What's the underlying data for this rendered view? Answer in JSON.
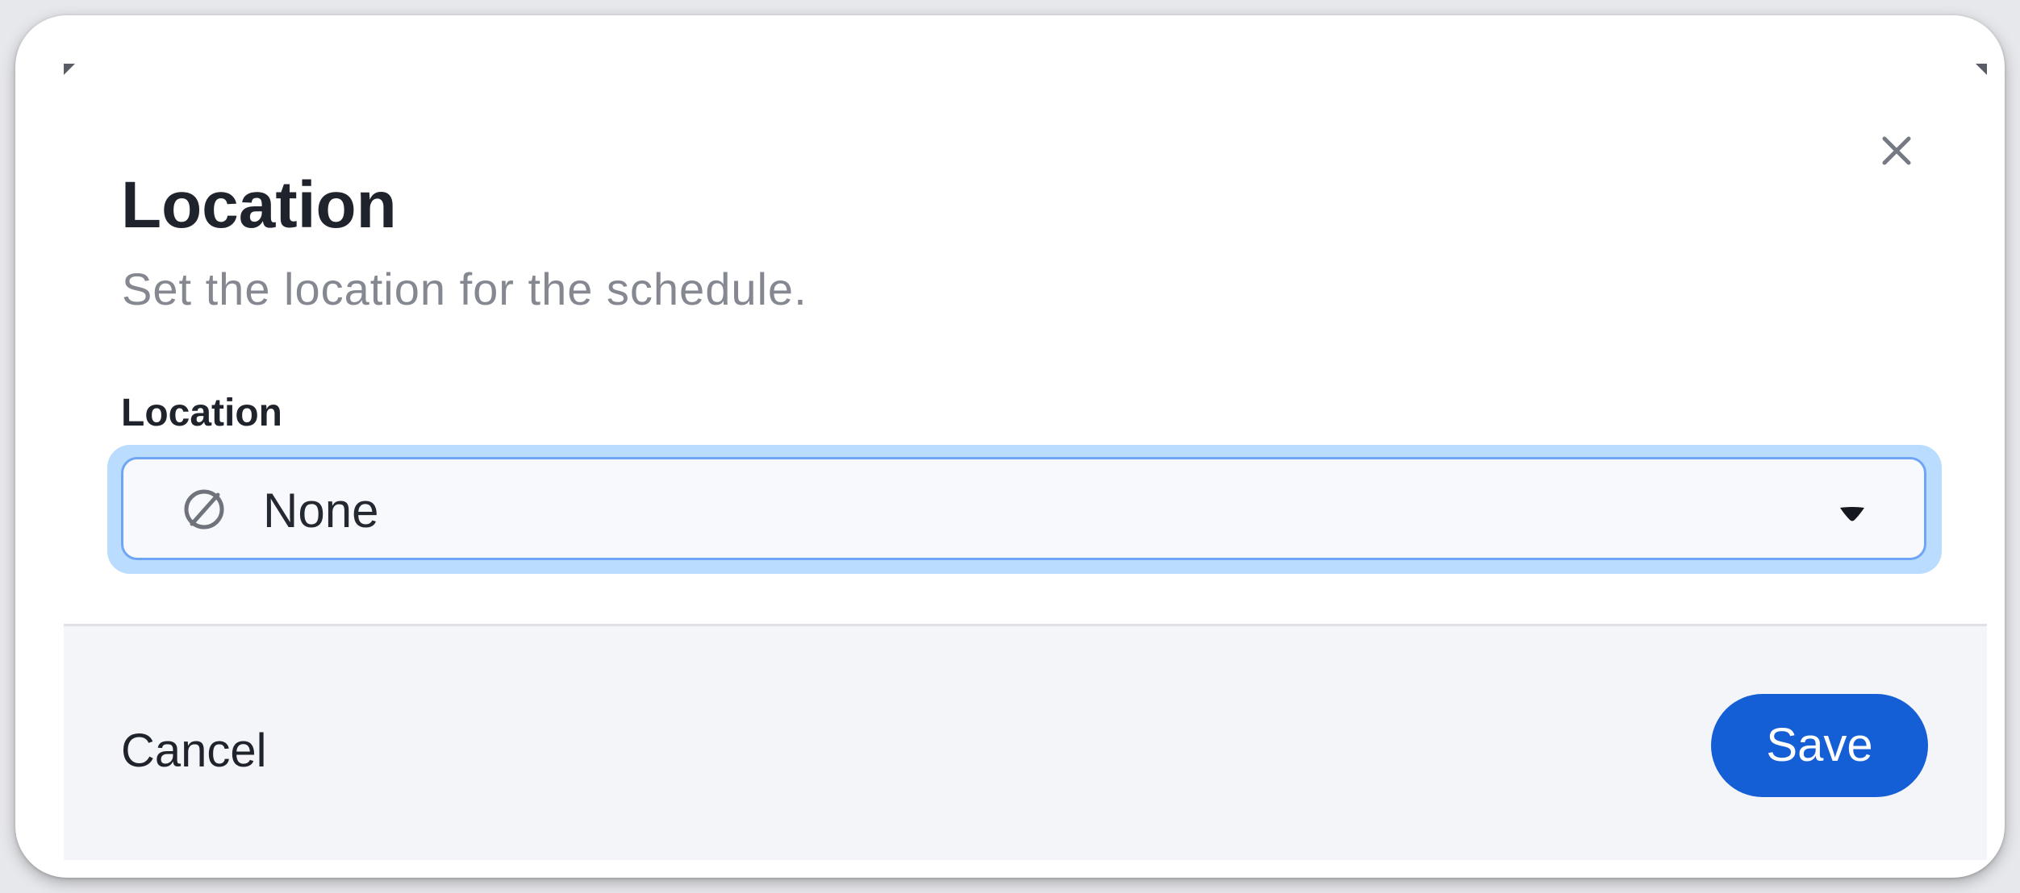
{
  "dialog": {
    "title": "Location",
    "subtitle": "Set the location for the schedule.",
    "close_icon": "close-icon"
  },
  "field": {
    "label": "Location",
    "selected_value": "None",
    "selected_icon": "empty-set-icon",
    "dropdown_icon": "chevron-down-icon"
  },
  "footer": {
    "cancel_label": "Cancel",
    "save_label": "Save"
  },
  "colors": {
    "primary": "#155fd6",
    "focus_ring": "#b9dcff",
    "select_border": "#6ea6f5",
    "text": "#1f232b",
    "muted_text": "#858891",
    "footer_background": "#f4f5f9"
  }
}
